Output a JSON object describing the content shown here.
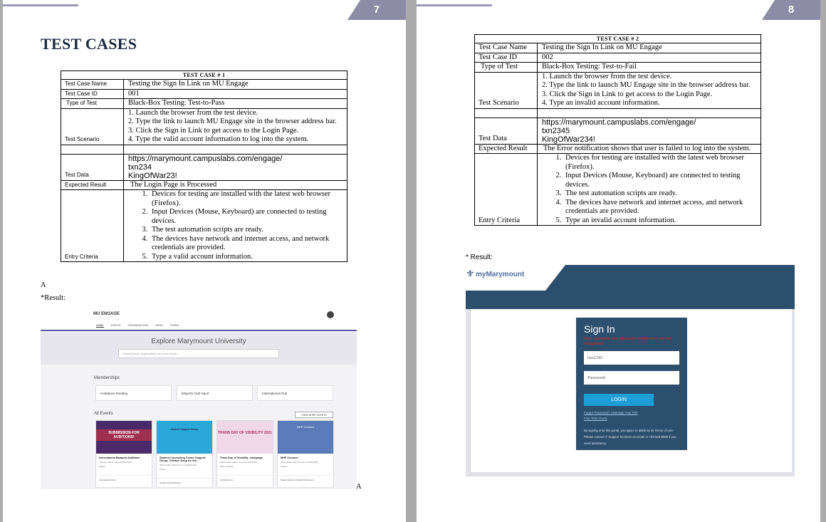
{
  "page7": {
    "page_number": "7",
    "title": "TEST CASES",
    "test_case": {
      "header": "TEST CASE # 1",
      "labels": {
        "name": "Test Case Name",
        "id": "Test Case ID",
        "type": "Type of Test",
        "scenario": "Test Scenario",
        "data": "Test Data",
        "expected": "Expected Result",
        "entry": "Entry Criteria"
      },
      "name": "Testing the Sign In Link on MU Engage",
      "id": "001",
      "type": "Black-Box Testing: Test-to-Pass",
      "scenario": [
        "1. Launch the browser from the test device.",
        "2. Type the link to launch MU Engage site in the browser address bar.",
        "3. Click the Sign in Link to get access to the Login Page.",
        "4. Type the valid account information to log into the system."
      ],
      "data": [
        "https://marymount.campuslabs.com/engage/",
        "txn234",
        "KingOfWar23!"
      ],
      "expected": "The Login Page is Processed",
      "entry": [
        "Devices for testing are installed with the latest web browser (Firefox).",
        "Input Devices (Mouse, Keyboard) are connected to testing devices.",
        "The test automation scripts are ready.",
        "The devices have network and internet access, and network credentials are provided.",
        "Type a valid account information."
      ]
    },
    "stray_a": "A",
    "result_label": "*Result:",
    "stray_a2": "A",
    "engage": {
      "logo": "MU ENGAGE",
      "nav": [
        "HOME",
        "EVENTS",
        "ORGANIZATIONS",
        "NEWS",
        "FORMS"
      ],
      "explore": "Explore Marymount University",
      "search_placeholder": "Search Events, Organizations, and News Articles",
      "memberships": "Memberships",
      "membership_items": [
        "Invitations Pending",
        "ESports Club Sport",
        "International Club"
      ],
      "all_events": "All Events",
      "view_more": "VIEW MORE EVENTS",
      "events": [
        {
          "banner": "SUBMISSION FOR AUDITIONS!",
          "title": "International Banquet Auditions",
          "date": "Tuesday, March 30 at 8:00AM EDT",
          "loc": "Online",
          "org": "International Club"
        },
        {
          "banner": "Student Support Group",
          "title": "Student Counseling Center Support Group: Chicken Soup for the...",
          "date": "Wednesday, March 31 at 11:00AM EDT",
          "loc": "Online",
          "org": "Health and Well-being"
        },
        {
          "banner": "TRANS DAY OF VISIBILITY 2021",
          "title": "Trans Day of Visibility- Campaign",
          "date": "Wednesday, March 31 at 11:00AM EDT",
          "loc": "Main Campus",
          "org": "Full Spectrum"
        },
        {
          "banner": "MHP Connect",
          "title": "MHP Connect",
          "date": "Wednesday, March 31 at 12:00PM EDT",
          "loc": "Online",
          "org": "Malek School of Health Professions"
        }
      ]
    }
  },
  "page8": {
    "page_number": "8",
    "test_case": {
      "header": "TEST CASE # 2",
      "labels": {
        "name": "Test Case Name",
        "id": "Test Case ID",
        "type": "Type of Test",
        "scenario": "Test Scenario",
        "data": "Test Data",
        "expected": "Expected Result",
        "entry": "Entry Criteria"
      },
      "name": "Testing the Sign In Link on MU Engage",
      "id": "002",
      "type": "Black-Box Testing: Test-to-Fail",
      "scenario": [
        "1. Launch the browser from the test device.",
        "2. Type the link to launch MU Engage site in the browser address bar.",
        "3. Click the Sign in Link to get access to the Login Page.",
        "4. Type an invalid account information."
      ],
      "data": [
        "https://marymount.campuslabs.com/engage/",
        "txn2345",
        "KingOfWar234!"
      ],
      "expected": "The Error notification shows that user is failed to log into the system.",
      "entry": [
        "Devices for testing are installed with the latest web browser (Firefox).",
        "Input Devices (Mouse, Keyboard) are connected to testing devices.",
        "The test automation scripts are ready.",
        "The devices have network and internet access, and network credentials are provided.",
        "Type an invalid account information."
      ]
    },
    "result_label": "* Result:",
    "signin": {
      "brand_prefix": "my",
      "brand": "Marymount",
      "heading": "Sign In",
      "error": "Your username and password combination are not recognized",
      "username_value": "txn2345",
      "password_placeholder": "Password",
      "login": "LOGIN",
      "forgot": "Forgot Password? | Manage Your PIN",
      "first_time": "First Time Users",
      "terms": "By signing onto this portal, you agree to abide by its Terms of Use. Please contact IT Support Services via email or 703-526-5999 if you need assistance."
    }
  },
  "colors": {
    "page_number_bg": "#8c8ca6",
    "title": "#1d2a40",
    "signin_blue": "#2d4f6e",
    "login_button": "#1c9ed8"
  }
}
